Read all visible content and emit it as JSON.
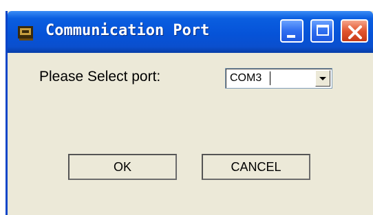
{
  "window": {
    "title": "Communication Port",
    "icon": "app-icon"
  },
  "titlebar_buttons": {
    "minimize": "minimize-icon",
    "maximize": "maximize-icon",
    "close": "close-icon"
  },
  "form": {
    "prompt_label": "Please Select port:",
    "port_value": "COM3"
  },
  "buttons": {
    "ok_label": "OK",
    "cancel_label": "CANCEL"
  },
  "colors": {
    "titlebar": "#0653d8",
    "close_button": "#e2562f",
    "face": "#ece9d8"
  }
}
